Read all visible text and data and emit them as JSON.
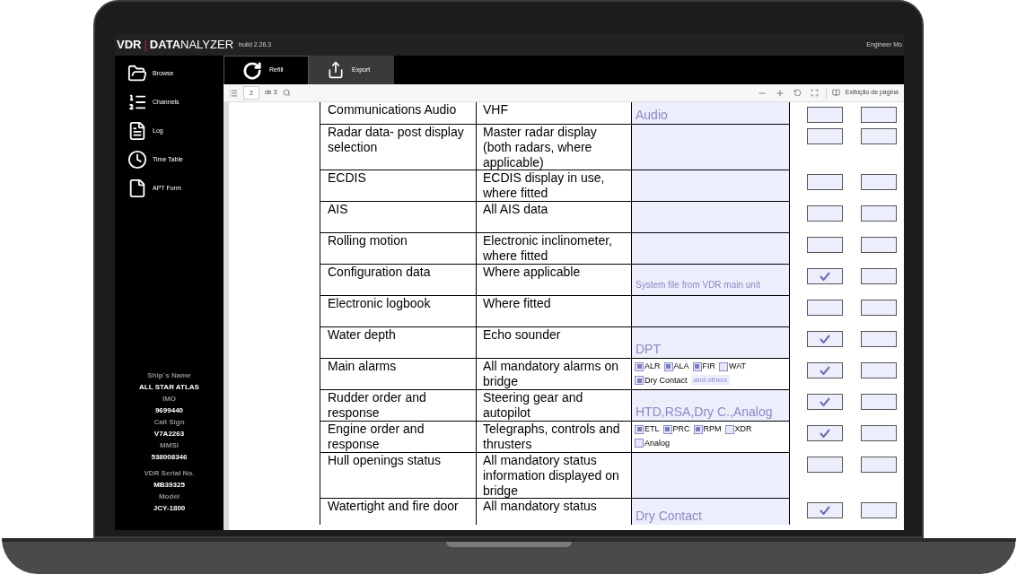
{
  "title_bar": {
    "logo_prefix": "VDR",
    "logo_separator": "|",
    "logo_name": "**DATA**NALYZER",
    "build": "build 2.26.3",
    "mode": "Engineer Mo"
  },
  "sidebar": {
    "items": [
      {
        "label": "Browse"
      },
      {
        "label": "Channels"
      },
      {
        "label": "Log"
      },
      {
        "label": "Time Table"
      },
      {
        "label": "APT Form"
      }
    ],
    "ship_info": [
      {
        "label": "Ship`s Name",
        "value": "ALL STAR ATLAS"
      },
      {
        "label": "IMO",
        "value": "9699440"
      },
      {
        "label": "Call Sign",
        "value": "V7A2263"
      },
      {
        "label": "MMSI",
        "value": "538008346"
      },
      {
        "label": "VDR Serial No.",
        "value": "MB39325"
      },
      {
        "label": "Model",
        "value": "JCY-1800"
      }
    ]
  },
  "tabs": [
    {
      "label": "Refill",
      "selected": true
    },
    {
      "label": "Export",
      "selected": false
    }
  ],
  "pdf_toolbar": {
    "page": "2",
    "page_count": "de 3",
    "view": "Exibição de página"
  },
  "table": {
    "rows": [
      {
        "item": "Communications Audio",
        "detail": "VHF",
        "source": {
          "kind": "large",
          "text": "Audio"
        },
        "boxes": [
          {
            "checked": false
          },
          {
            "checked": false
          }
        ]
      },
      {
        "item": "Radar data- post display selection",
        "detail": "Master radar display (both radars, where applicable)",
        "boxes": [
          {
            "checked": false
          },
          {
            "checked": false
          }
        ]
      },
      {
        "item": "ECDIS",
        "detail": "ECDIS display in use, where fitted",
        "boxes": [
          {
            "checked": false
          },
          {
            "checked": false
          }
        ]
      },
      {
        "item": "AIS",
        "detail": "All AIS data",
        "boxes": [
          {
            "checked": false
          },
          {
            "checked": false
          }
        ]
      },
      {
        "item": "Rolling motion",
        "detail": "Electronic inclinometer, where fitted",
        "boxes": [
          {
            "checked": false
          },
          {
            "checked": false
          }
        ]
      },
      {
        "item": "Configuration data",
        "detail": "Where applicable",
        "source": {
          "kind": "small",
          "text": "System file from VDR main unit"
        },
        "boxes": [
          {
            "checked": true
          },
          {
            "checked": false
          }
        ]
      },
      {
        "item": "Electronic logbook",
        "detail": "Where fitted",
        "boxes": [
          {
            "checked": false
          },
          {
            "checked": false
          }
        ]
      },
      {
        "item": "Water depth",
        "detail": "Echo sounder",
        "source": {
          "kind": "large",
          "text": "DPT"
        },
        "boxes": [
          {
            "checked": true
          },
          {
            "checked": false
          }
        ]
      },
      {
        "item": "Main alarms",
        "detail": "All mandatory alarms on bridge",
        "source": {
          "kind": "options",
          "options": [
            {
              "label": "ALR",
              "checked": true
            },
            {
              "label": "ALA",
              "checked": true
            },
            {
              "label": "FIR",
              "checked": true
            },
            {
              "label": "WAT",
              "checked": false
            },
            {
              "label": "Dry Contact",
              "checked": true
            }
          ],
          "note": "and others"
        },
        "boxes": [
          {
            "checked": true
          },
          {
            "checked": false
          }
        ]
      },
      {
        "item": "Rudder order and response",
        "detail": "Steering gear and autopilot",
        "source": {
          "kind": "large",
          "text": "HTD,RSA,Dry C.,Analog"
        },
        "boxes": [
          {
            "checked": true
          },
          {
            "checked": false
          }
        ]
      },
      {
        "item": "Engine order and response",
        "detail": "Telegraphs, controls and thrusters",
        "source": {
          "kind": "options",
          "options": [
            {
              "label": "ETL",
              "checked": true
            },
            {
              "label": "PRC",
              "checked": true
            },
            {
              "label": "RPM",
              "checked": true
            },
            {
              "label": "XDR",
              "checked": false
            },
            {
              "label": "Analog",
              "checked": false
            }
          ]
        },
        "boxes": [
          {
            "checked": true
          },
          {
            "checked": false
          }
        ]
      },
      {
        "item": "Hull openings status",
        "detail": "All mandatory status information displayed on bridge",
        "boxes": [
          {
            "checked": false
          },
          {
            "checked": false
          }
        ]
      },
      {
        "item": "Watertight and fire door",
        "detail": "All mandatory status",
        "source": {
          "kind": "large",
          "text": "Dry Contact"
        },
        "boxes": [
          {
            "checked": true
          },
          {
            "checked": false
          }
        ]
      }
    ]
  }
}
